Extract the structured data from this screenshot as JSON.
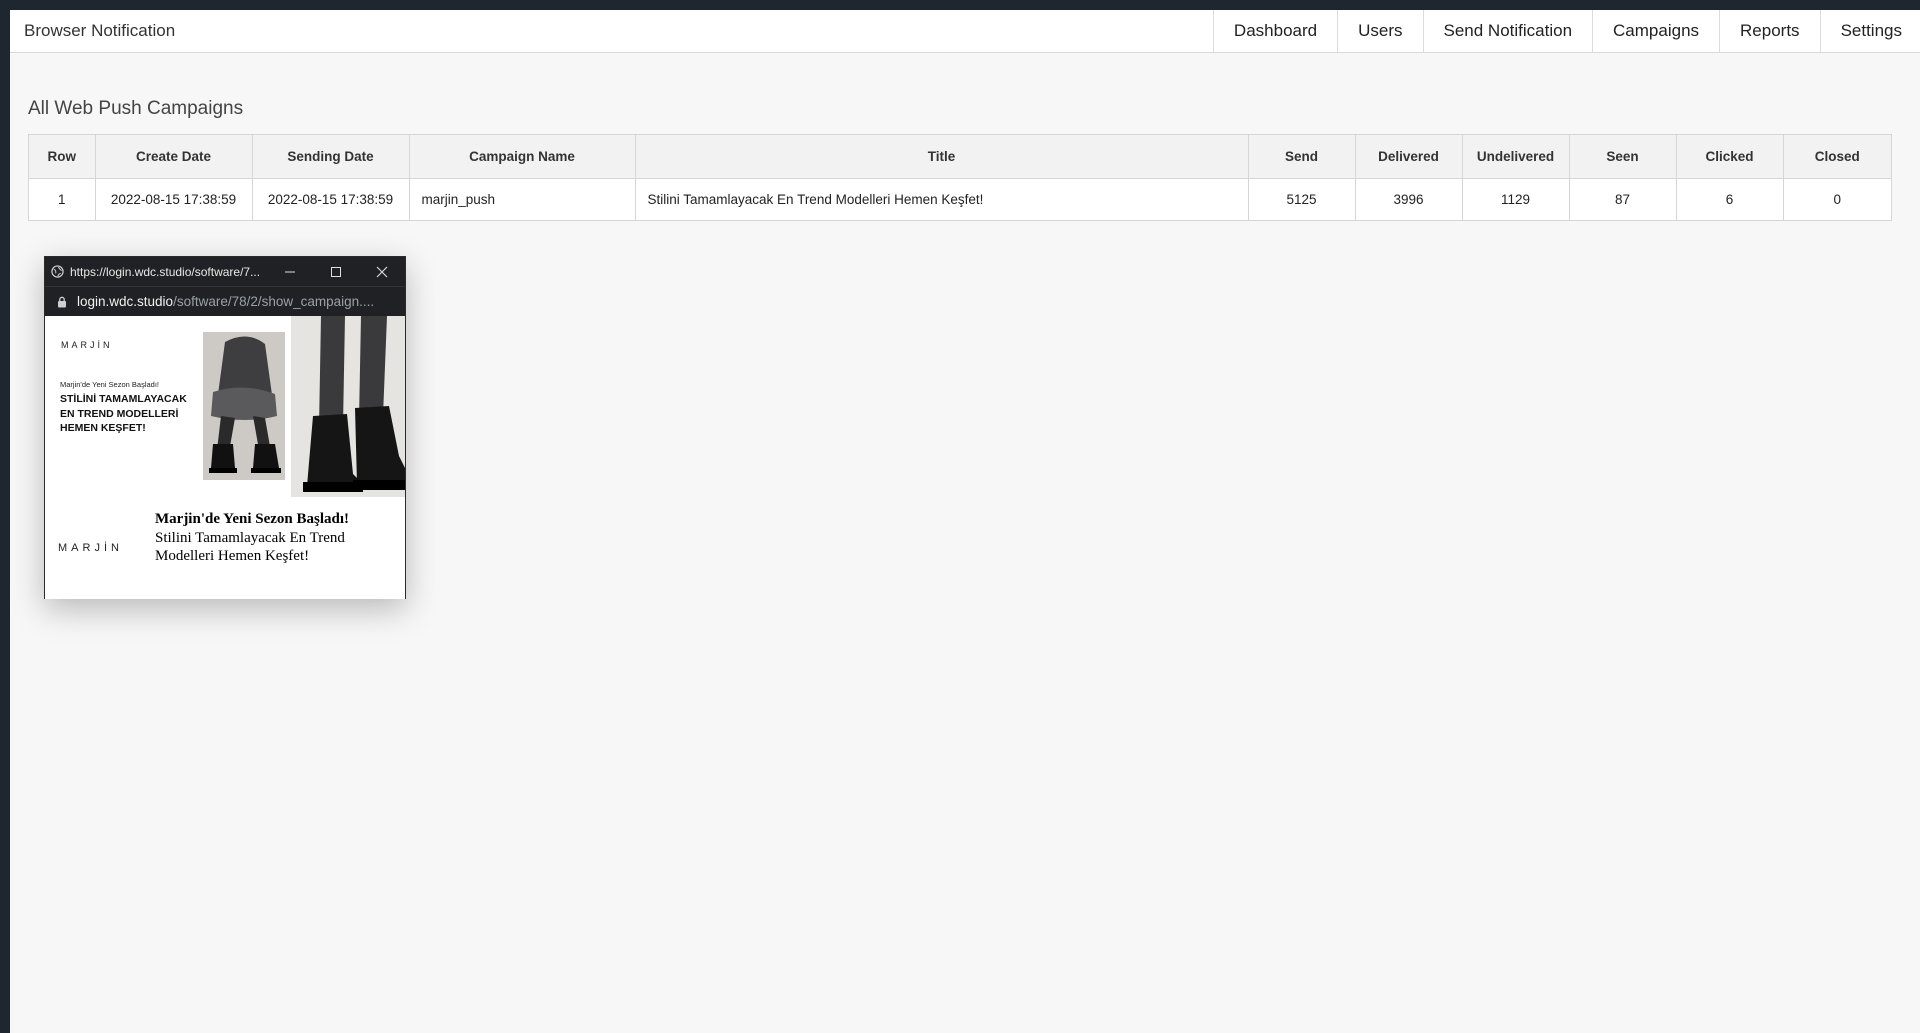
{
  "navbar": {
    "brand": "Browser Notification",
    "items": [
      {
        "label": "Dashboard"
      },
      {
        "label": "Users"
      },
      {
        "label": "Send Notification"
      },
      {
        "label": "Campaigns"
      },
      {
        "label": "Reports"
      },
      {
        "label": "Settings"
      }
    ]
  },
  "page": {
    "title": "All Web Push Campaigns"
  },
  "table": {
    "headers": [
      "Row",
      "Create Date",
      "Sending Date",
      "Campaign Name",
      "Title",
      "Send",
      "Delivered",
      "Undelivered",
      "Seen",
      "Clicked",
      "Closed"
    ],
    "rows": [
      [
        "1",
        "2022-08-15 17:38:59",
        "2022-08-15 17:38:59",
        "marjin_push",
        "Stilini Tamamlayacak En Trend Modelleri Hemen Keşfet!",
        "5125",
        "3996",
        "1129",
        "87",
        "6",
        "0"
      ]
    ]
  },
  "popup": {
    "window_title": "https://login.wdc.studio/software/7...",
    "address_host": "login.wdc.studio",
    "address_path": "/software/78/2/show_campaign....",
    "banner": {
      "brand": "MARJİN",
      "small_text": "Marjin'de Yeni Sezon Başladı!",
      "big_text": "STİLİNİ TAMAMLAYACAK EN TREND MODELLERİ HEMEN KEŞFET!"
    },
    "notification": {
      "logo": "MARJİN",
      "title": "Marjin'de Yeni Sezon Başladı!",
      "body": "Stilini Tamamlayacak En Trend Modelleri Hemen Keşfet!"
    }
  },
  "colors": {
    "page_background": "#f7f7f7",
    "frame_background": "#1e2630",
    "popup_chrome": "#202124"
  }
}
